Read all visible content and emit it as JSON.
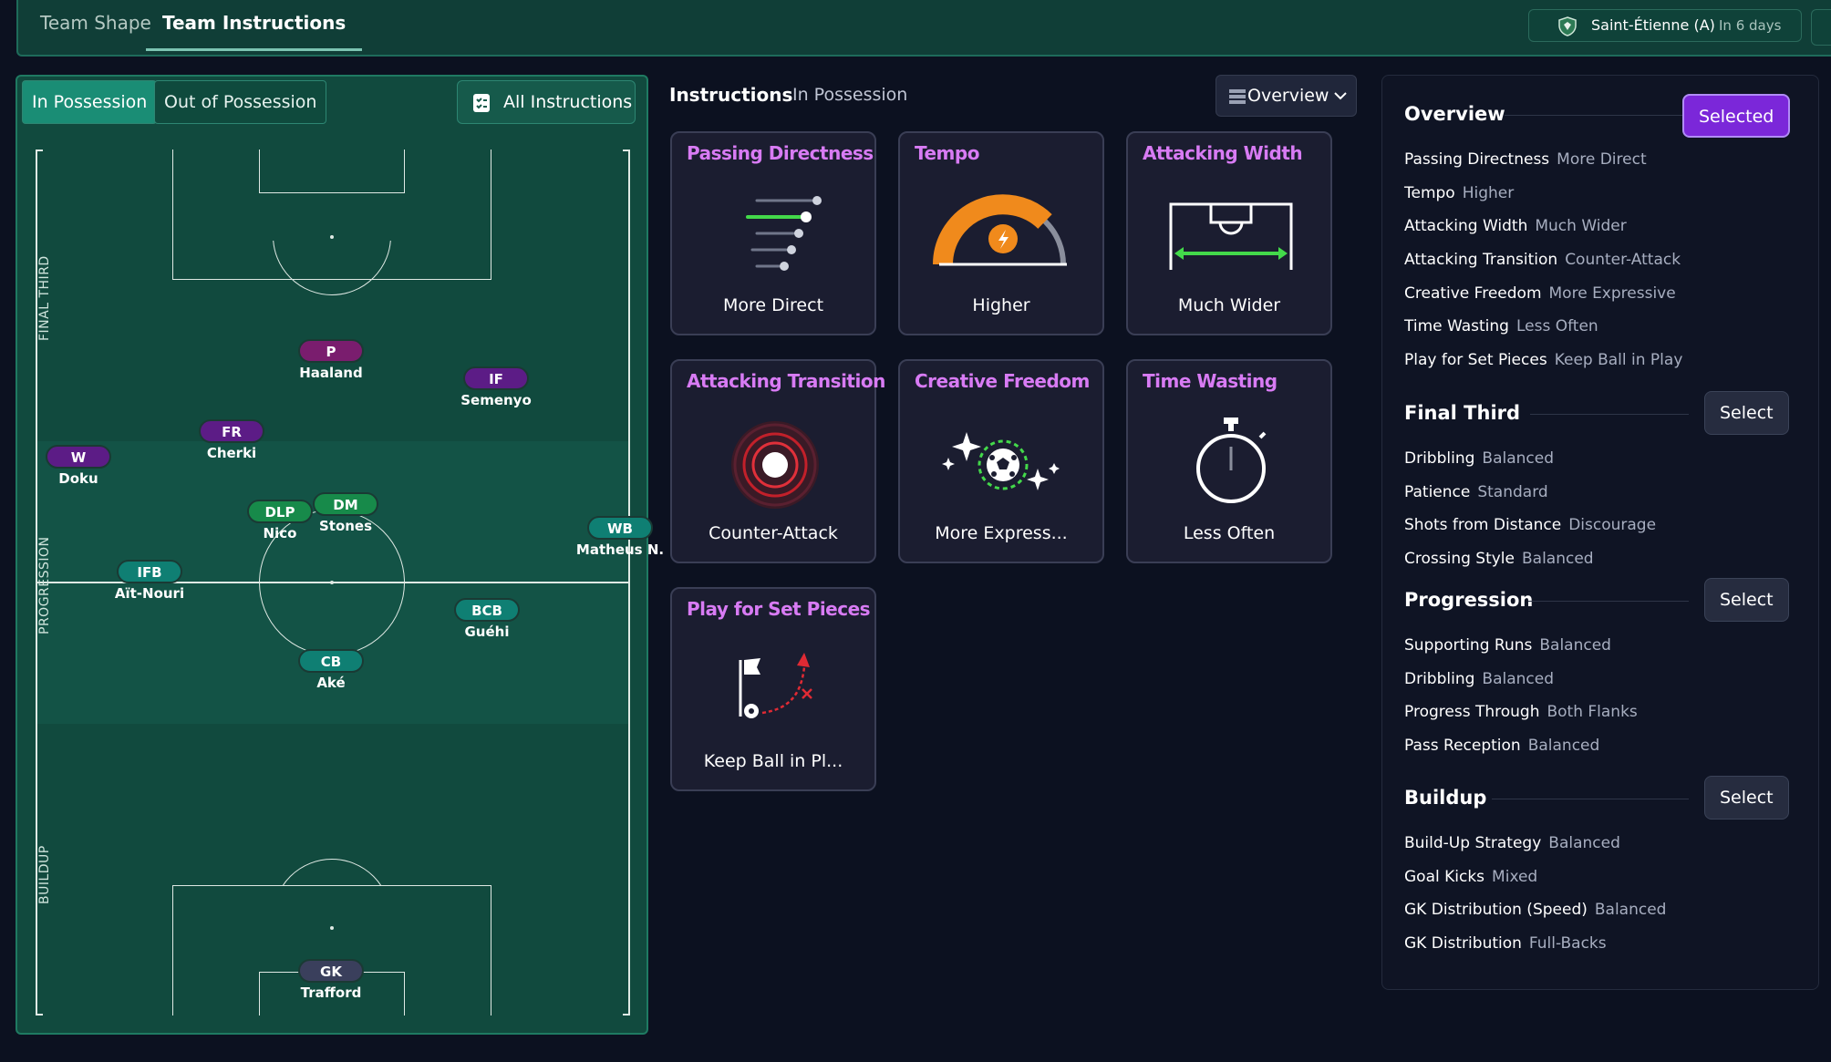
{
  "tabs": [
    "Team Shape",
    "Team Instructions"
  ],
  "fixture": {
    "opponent": "Saint-Étienne (A)",
    "when": "In 6 days"
  },
  "left": {
    "seg": [
      "In Possession",
      "Out of Possession"
    ],
    "all_instructions": "All Instructions",
    "zones": [
      "FINAL THIRD",
      "PROGRESSION",
      "BUILDUP"
    ],
    "players": [
      {
        "pos": "P",
        "name": "Haaland"
      },
      {
        "pos": "IF",
        "name": "Semenyo"
      },
      {
        "pos": "FR",
        "name": "Cherki"
      },
      {
        "pos": "W",
        "name": "Doku"
      },
      {
        "pos": "DLP",
        "name": "Nico"
      },
      {
        "pos": "DM",
        "name": "Stones"
      },
      {
        "pos": "WB",
        "name": "Matheus N."
      },
      {
        "pos": "IFB",
        "name": "Aït-Nouri"
      },
      {
        "pos": "BCB",
        "name": "Guéhi"
      },
      {
        "pos": "CB",
        "name": "Aké"
      },
      {
        "pos": "GK",
        "name": "Trafford"
      }
    ]
  },
  "mid": {
    "title": "Instructions",
    "subtitle": "In Possession",
    "dropdown": "Overview",
    "cards": [
      {
        "title": "Passing Directness",
        "value": "More Direct"
      },
      {
        "title": "Tempo",
        "value": "Higher"
      },
      {
        "title": "Attacking Width",
        "value": "Much Wider"
      },
      {
        "title": "Attacking Transition",
        "value": "Counter-Attack"
      },
      {
        "title": "Creative Freedom",
        "value": "More Express..."
      },
      {
        "title": "Time Wasting",
        "value": "Less Often"
      },
      {
        "title": "Play for Set Pieces",
        "value": "Keep Ball in Pl..."
      }
    ]
  },
  "right": {
    "sections": [
      {
        "title": "Overview",
        "button": "Selected",
        "rows": [
          {
            "k": "Passing Directness",
            "v": "More Direct"
          },
          {
            "k": "Tempo",
            "v": "Higher"
          },
          {
            "k": "Attacking Width",
            "v": "Much Wider"
          },
          {
            "k": "Attacking Transition",
            "v": "Counter-Attack"
          },
          {
            "k": "Creative Freedom",
            "v": "More Expressive"
          },
          {
            "k": "Time Wasting",
            "v": "Less Often"
          },
          {
            "k": "Play for Set Pieces",
            "v": "Keep Ball in Play"
          }
        ]
      },
      {
        "title": "Final Third",
        "button": "Select",
        "rows": [
          {
            "k": "Dribbling",
            "v": "Balanced"
          },
          {
            "k": "Patience",
            "v": "Standard"
          },
          {
            "k": "Shots from Distance",
            "v": "Discourage"
          },
          {
            "k": "Crossing Style",
            "v": "Balanced"
          }
        ]
      },
      {
        "title": "Progression",
        "button": "Select",
        "rows": [
          {
            "k": "Supporting Runs",
            "v": "Balanced"
          },
          {
            "k": "Dribbling",
            "v": "Balanced"
          },
          {
            "k": "Progress Through",
            "v": "Both Flanks"
          },
          {
            "k": "Pass Reception",
            "v": "Balanced"
          }
        ]
      },
      {
        "title": "Buildup",
        "button": "Select",
        "rows": [
          {
            "k": "Build-Up Strategy",
            "v": "Balanced"
          },
          {
            "k": "Goal Kicks",
            "v": "Mixed"
          },
          {
            "k": "GK Distribution (Speed)",
            "v": "Balanced"
          },
          {
            "k": "GK Distribution",
            "v": "Full-Backs"
          }
        ]
      }
    ]
  },
  "colors": {
    "accent_purple": "#7b27d9",
    "card_title": "#d87bf4",
    "pitch": "#114a3e"
  }
}
